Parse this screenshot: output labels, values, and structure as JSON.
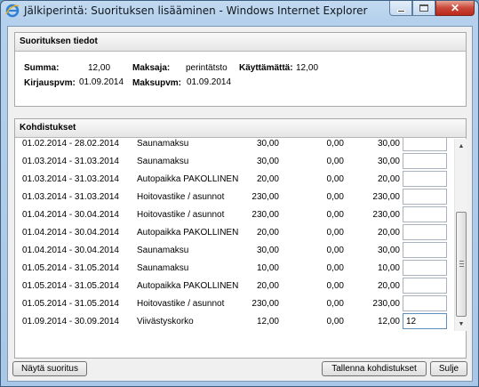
{
  "window": {
    "title": "Jälkiperintä: Suorituksen lisääminen - Windows Internet Explorer",
    "close_glyph": "✕"
  },
  "info_panel": {
    "title": "Suorituksen tiedot",
    "summa_label": "Summa:",
    "summa_value": "12,00",
    "maksaja_label": "Maksaja:",
    "maksaja_value": "perintätsto",
    "kayttamatta_label": "Käyttämättä:",
    "kayttamatta_value": "12,00",
    "kirjauspvm_label": "Kirjauspvm:",
    "kirjauspvm_value": "01.09.2014",
    "maksupvm_label": "Maksupvm:",
    "maksupvm_value": "01.09.2014"
  },
  "allocations": {
    "title": "Kohdistukset",
    "rows": [
      {
        "period": "01.02.2014 - 28.02.2014",
        "desc": "Saunamaksu",
        "a": "30,00",
        "b": "0,00",
        "c": "30,00",
        "input": ""
      },
      {
        "period": "01.03.2014 - 31.03.2014",
        "desc": "Saunamaksu",
        "a": "30,00",
        "b": "0,00",
        "c": "30,00",
        "input": ""
      },
      {
        "period": "01.03.2014 - 31.03.2014",
        "desc": "Autopaikka PAKOLLINEN",
        "a": "20,00",
        "b": "0,00",
        "c": "20,00",
        "input": ""
      },
      {
        "period": "01.03.2014 - 31.03.2014",
        "desc": "Hoitovastike / asunnot",
        "a": "230,00",
        "b": "0,00",
        "c": "230,00",
        "input": ""
      },
      {
        "period": "01.04.2014 - 30.04.2014",
        "desc": "Hoitovastike / asunnot",
        "a": "230,00",
        "b": "0,00",
        "c": "230,00",
        "input": ""
      },
      {
        "period": "01.04.2014 - 30.04.2014",
        "desc": "Autopaikka PAKOLLINEN",
        "a": "20,00",
        "b": "0,00",
        "c": "20,00",
        "input": ""
      },
      {
        "period": "01.04.2014 - 30.04.2014",
        "desc": "Saunamaksu",
        "a": "30,00",
        "b": "0,00",
        "c": "30,00",
        "input": ""
      },
      {
        "period": "01.05.2014 - 31.05.2014",
        "desc": "Saunamaksu",
        "a": "10,00",
        "b": "0,00",
        "c": "10,00",
        "input": ""
      },
      {
        "period": "01.05.2014 - 31.05.2014",
        "desc": "Autopaikka PAKOLLINEN",
        "a": "20,00",
        "b": "0,00",
        "c": "20,00",
        "input": ""
      },
      {
        "period": "01.05.2014 - 31.05.2014",
        "desc": "Hoitovastike / asunnot",
        "a": "230,00",
        "b": "0,00",
        "c": "230,00",
        "input": ""
      },
      {
        "period": "01.09.2014 - 30.09.2014",
        "desc": "Viivästyskorko",
        "a": "12,00",
        "b": "0,00",
        "c": "12,00",
        "input": "12"
      }
    ]
  },
  "buttons": {
    "show_payment": "Näytä suoritus",
    "save_allocations": "Tallenna kohdistukset",
    "close": "Sulje"
  }
}
